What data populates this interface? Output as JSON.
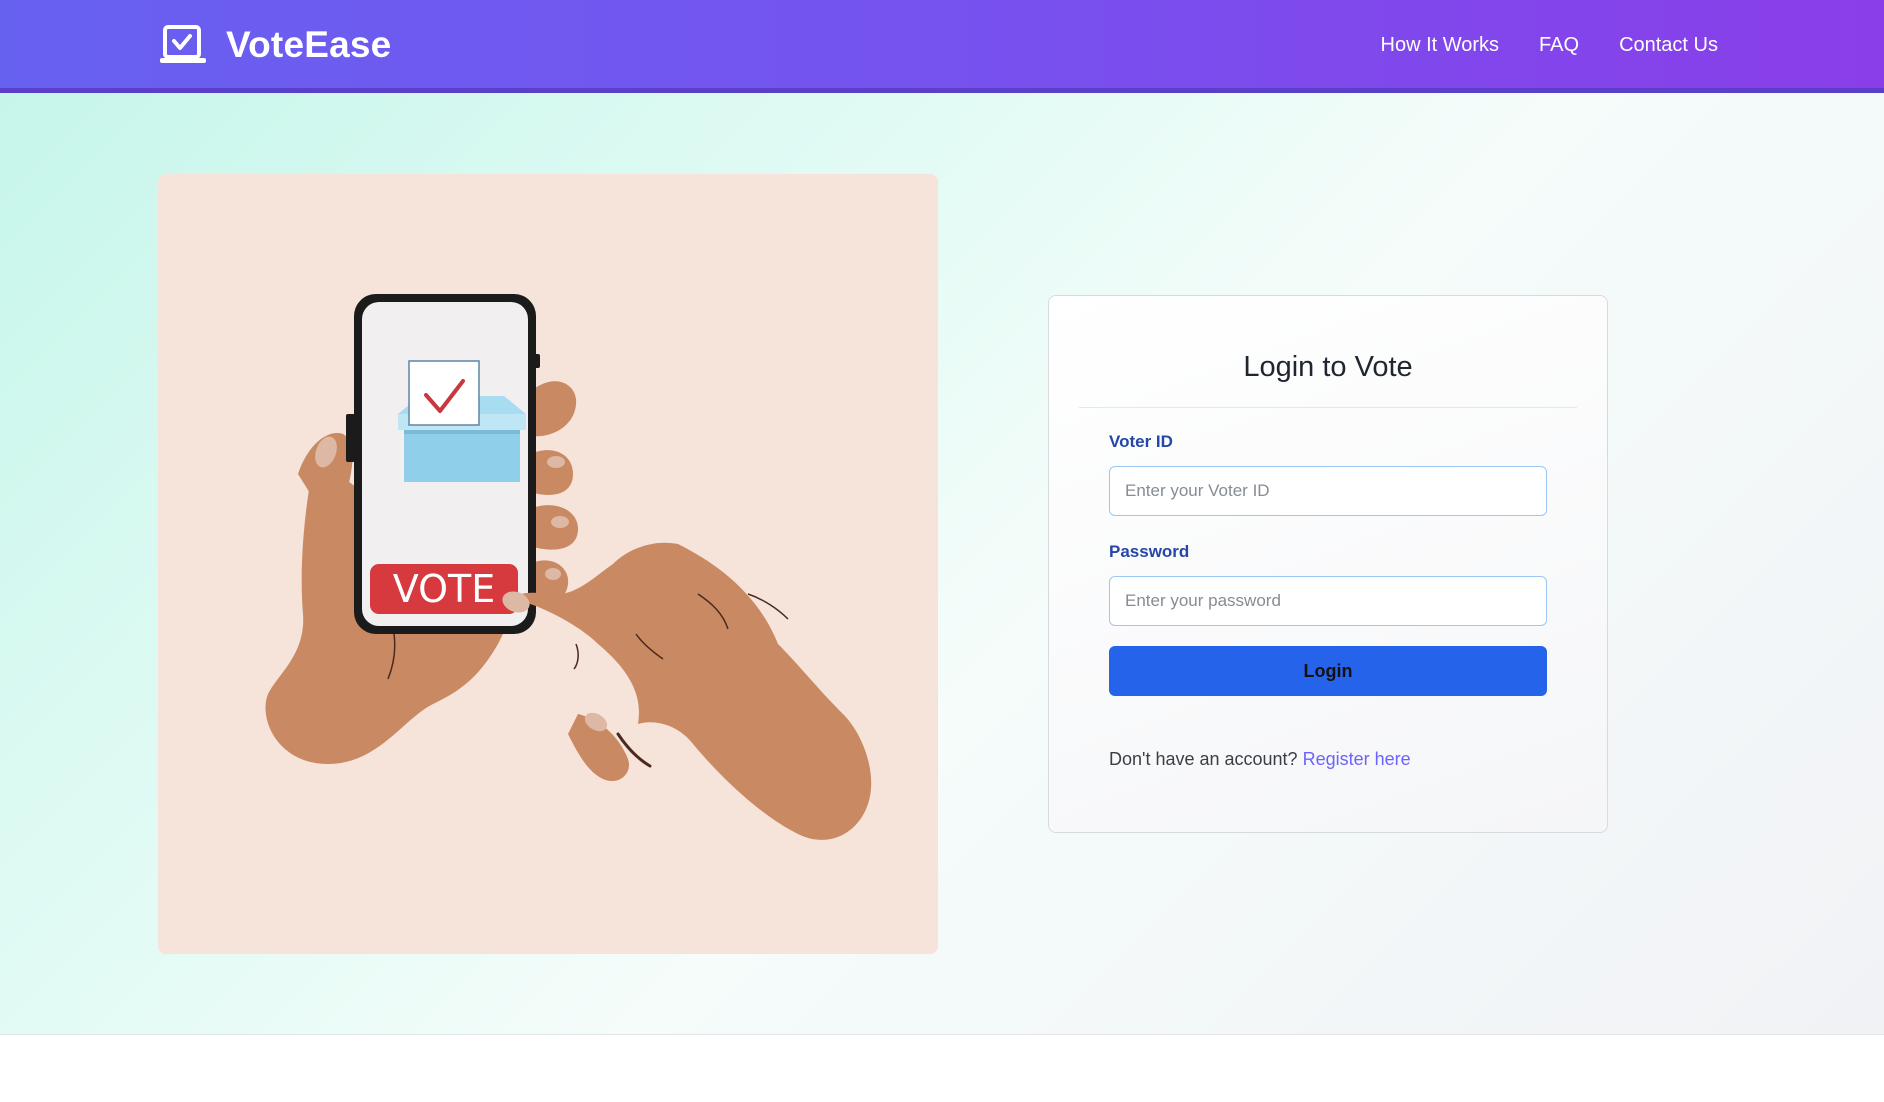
{
  "header": {
    "brand": "VoteEase",
    "logo_icon": "vote-check-icon",
    "nav": [
      "How It Works",
      "FAQ",
      "Contact Us"
    ]
  },
  "illustration": {
    "vote_button_text": "VOTE"
  },
  "login": {
    "title": "Login to Vote",
    "voter_id_label": "Voter ID",
    "voter_id_placeholder": "Enter your Voter ID",
    "password_label": "Password",
    "password_placeholder": "Enter your password",
    "button_label": "Login",
    "register_prompt": "Don't have an account?",
    "register_link": "Register here"
  },
  "colors": {
    "header_gradient_start": "#6761f0",
    "header_gradient_end": "#8a3ee9",
    "primary_button": "#2563eb",
    "label_color": "#2447a8",
    "link_color": "#6c63ff",
    "vote_red": "#d63a3f"
  }
}
